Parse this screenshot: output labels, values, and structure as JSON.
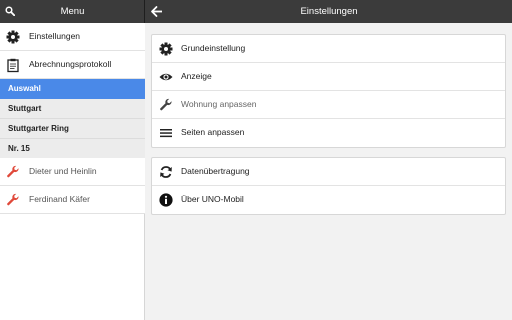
{
  "header": {
    "menu_title": "Menu",
    "page_title": "Einstellungen"
  },
  "sidebar": {
    "items": [
      {
        "label": "Einstellungen",
        "icon": "gear-icon"
      },
      {
        "label": "Abrechnungsprotokoll",
        "icon": "clipboard-icon"
      }
    ],
    "selection": {
      "heading": "Auswahl",
      "city": "Stuttgart",
      "street": "Stuttgarter Ring",
      "number": "Nr. 15"
    },
    "residents": [
      {
        "label": "Dieter und Heinlin",
        "icon": "wrench-icon"
      },
      {
        "label": "Ferdinand Käfer",
        "icon": "wrench-icon"
      }
    ]
  },
  "settings": {
    "group1": [
      {
        "label": "Grundeinstellung",
        "icon": "gear-icon"
      },
      {
        "label": "Anzeige",
        "icon": "eye-icon"
      },
      {
        "label": "Wohnung anpassen",
        "icon": "wrench-icon"
      },
      {
        "label": "Seiten anpassen",
        "icon": "list-icon"
      }
    ],
    "group2": [
      {
        "label": "Datenübertragung",
        "icon": "sync-icon"
      },
      {
        "label": "Über UNO-Mobil",
        "icon": "info-icon"
      }
    ]
  },
  "colors": {
    "topbar": "#3b3b3b",
    "active": "#4a89e8",
    "wrench": "#e0493a"
  }
}
